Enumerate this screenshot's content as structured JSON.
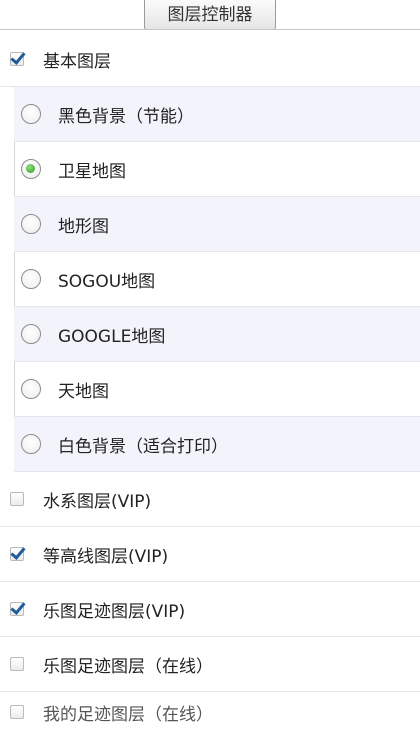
{
  "panel": {
    "title": "图层控制器"
  },
  "base_layer": {
    "label": "基本图层",
    "checked": true
  },
  "base_options": [
    {
      "label": "黑色背景（节能）",
      "selected": false
    },
    {
      "label": "卫星地图",
      "selected": true
    },
    {
      "label": "地形图",
      "selected": false
    },
    {
      "label": "SOGOU地图",
      "selected": false
    },
    {
      "label": "GOOGLE地图",
      "selected": false
    },
    {
      "label": "天地图",
      "selected": false
    },
    {
      "label": "白色背景（适合打印）",
      "selected": false
    }
  ],
  "overlays": [
    {
      "label": "水系图层(VIP)",
      "checked": false
    },
    {
      "label": "等高线图层(VIP)",
      "checked": true
    },
    {
      "label": "乐图足迹图层(VIP)",
      "checked": true
    },
    {
      "label": "乐图足迹图层（在线）",
      "checked": false
    },
    {
      "label": "我的足迹图层（在线）",
      "checked": false
    }
  ]
}
